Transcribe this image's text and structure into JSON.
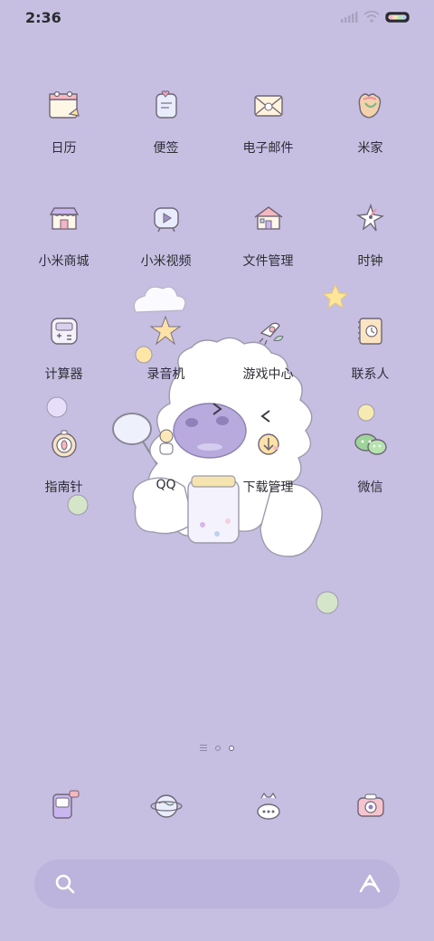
{
  "status_bar": {
    "time": "2:36",
    "icons": [
      "signal-icon",
      "wifi-icon",
      "battery-icon"
    ]
  },
  "apps": [
    {
      "label": "日历",
      "icon": "calendar-icon"
    },
    {
      "label": "便签",
      "icon": "notes-icon"
    },
    {
      "label": "电子邮件",
      "icon": "email-icon"
    },
    {
      "label": "米家",
      "icon": "mijia-icon"
    },
    {
      "label": "小米商城",
      "icon": "store-icon"
    },
    {
      "label": "小米视频",
      "icon": "video-icon"
    },
    {
      "label": "文件管理",
      "icon": "file-manager-icon"
    },
    {
      "label": "时钟",
      "icon": "clock-icon"
    },
    {
      "label": "计算器",
      "icon": "calculator-icon"
    },
    {
      "label": "录音机",
      "icon": "recorder-icon"
    },
    {
      "label": "游戏中心",
      "icon": "game-center-icon"
    },
    {
      "label": "联系人",
      "icon": "contacts-icon"
    },
    {
      "label": "指南针",
      "icon": "compass-icon"
    },
    {
      "label": "QQ",
      "icon": "qq-icon"
    },
    {
      "label": "下载管理",
      "icon": "download-icon"
    },
    {
      "label": "微信",
      "icon": "wechat-icon"
    }
  ],
  "page_indicator": {
    "pages": 2,
    "active": 2
  },
  "dock": [
    {
      "icon": "phone-icon"
    },
    {
      "icon": "browser-icon"
    },
    {
      "icon": "messages-icon"
    },
    {
      "icon": "camera-icon"
    }
  ],
  "search": {
    "placeholder": "",
    "icon": "search-icon",
    "assistant_icon": "assistant-icon"
  },
  "colors": {
    "wallpaper": "#c6bfe2",
    "search_bar": "#bcb4dc"
  }
}
